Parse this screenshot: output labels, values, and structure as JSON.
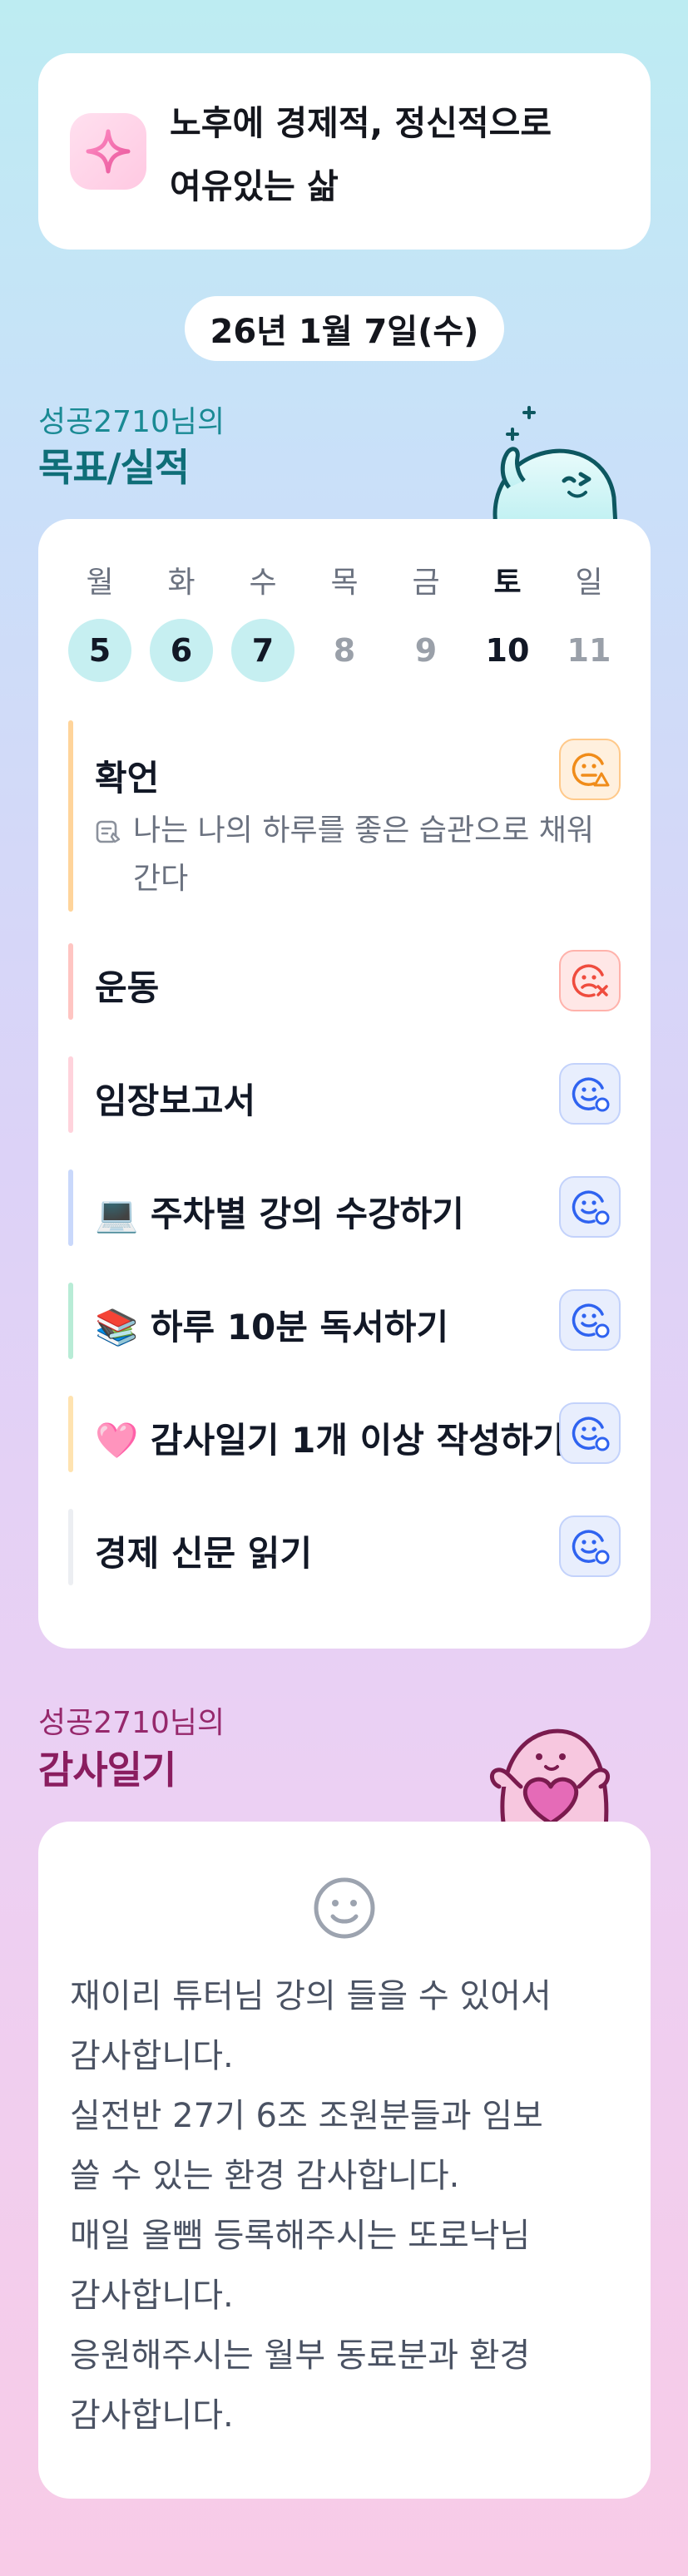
{
  "goal": {
    "icon": "sparkle-icon",
    "text": "노후에 경제적, 정신적으로\n여유있는 삶"
  },
  "date": "26년 1월 7일(수)",
  "goals_section": {
    "subtitle": "성공2710님의",
    "title": "목표/실적"
  },
  "week": [
    {
      "name": "월",
      "date": "5",
      "state": "done"
    },
    {
      "name": "화",
      "date": "6",
      "state": "done"
    },
    {
      "name": "수",
      "date": "7",
      "state": "done"
    },
    {
      "name": "목",
      "date": "8",
      "state": "future"
    },
    {
      "name": "금",
      "date": "9",
      "state": "future"
    },
    {
      "name": "토",
      "date": "10",
      "state": "today"
    },
    {
      "name": "일",
      "date": "11",
      "state": "future"
    }
  ],
  "items": [
    {
      "name": "확언",
      "bar_color": "#ffd49a",
      "status": "partial",
      "status_icon": "face-warning-icon",
      "note": "나는 나의 하루를 좋은 습관으로 채워간다",
      "note_icon": "memo-icon"
    },
    {
      "name": "운동",
      "bar_color": "#ffc5c2",
      "status": "failed",
      "status_icon": "face-x-icon"
    },
    {
      "name": "임장보고서",
      "bar_color": "#ffd3dc",
      "status": "done",
      "status_icon": "face-check-icon"
    },
    {
      "name": "💻 주차별 강의 수강하기",
      "bar_color": "#c9d8fb",
      "status": "done",
      "status_icon": "face-check-icon"
    },
    {
      "name": "📚 하루 10분 독서하기",
      "bar_color": "#b8ecd6",
      "status": "done",
      "status_icon": "face-check-icon"
    },
    {
      "name": "🩷 감사일기 1개 이상 작성하기",
      "bar_color": "#ffe3b0",
      "status": "done",
      "status_icon": "face-check-icon"
    },
    {
      "name": "경제 신문 읽기",
      "bar_color": "#eceef2",
      "status": "done",
      "status_icon": "face-check-icon"
    }
  ],
  "gratitude_section": {
    "subtitle": "성공2710님의",
    "title": "감사일기",
    "mood_icon": "smile-face-icon",
    "text": "재이리 튜터님 강의 들을 수 있어서\n감사합니다.\n실전반 27기 6조 조원분들과 임보\n쓸 수 있는 환경 감사합니다.\n매일 올뺌 등록해주시는 또로낙님\n감사합니다.\n응원해주시는 월부 동료분과 환경\n감사합니다."
  },
  "colors": {
    "teal_title": "#0f6e78",
    "magenta_title": "#8a1d5f",
    "done_day": "#c6eff1"
  }
}
